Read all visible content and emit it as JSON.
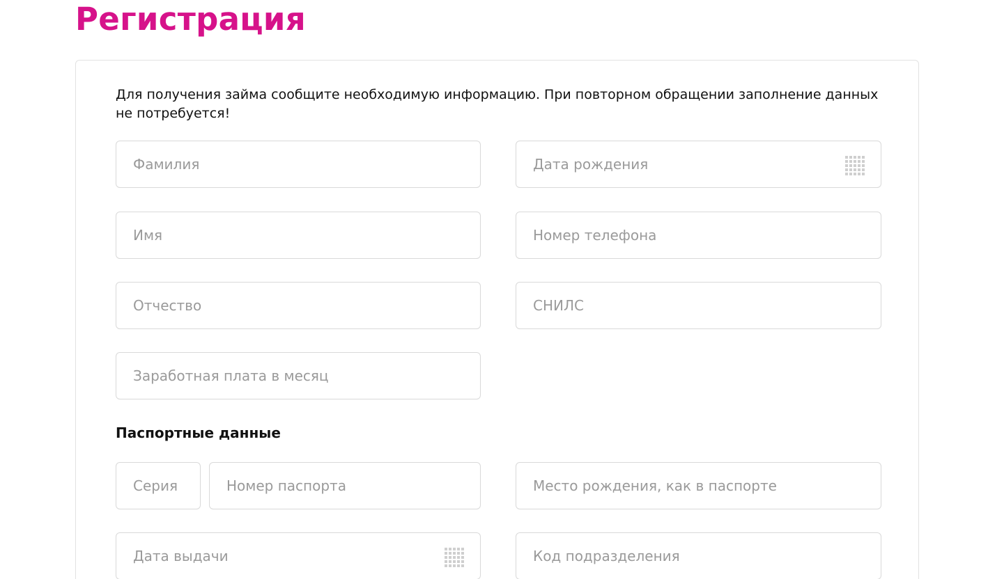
{
  "page": {
    "title": "Регистрация"
  },
  "form": {
    "intro": "Для получения займа сообщите необходимую информацию. При повторном обращении заполнение данных не потребуется!",
    "fields": {
      "last_name": {
        "placeholder": "Фамилия",
        "value": ""
      },
      "birth_date": {
        "placeholder": "Дата рождения",
        "value": "",
        "icon": "calendar-icon"
      },
      "first_name": {
        "placeholder": "Имя",
        "value": ""
      },
      "phone": {
        "placeholder": "Номер телефона",
        "value": ""
      },
      "patronymic": {
        "placeholder": "Отчество",
        "value": ""
      },
      "snils": {
        "placeholder": "СНИЛС",
        "value": ""
      },
      "salary": {
        "placeholder": "Заработная плата в месяц",
        "value": ""
      }
    },
    "passport": {
      "section_title": "Паспортные данные",
      "fields": {
        "series": {
          "placeholder": "Серия",
          "value": ""
        },
        "number": {
          "placeholder": "Номер паспорта",
          "value": ""
        },
        "birth_place": {
          "placeholder": "Место рождения, как в паспорте",
          "value": ""
        },
        "issue_date": {
          "placeholder": "Дата выдачи",
          "value": "",
          "icon": "calendar-icon"
        },
        "division_code": {
          "placeholder": "Код подразделения",
          "value": ""
        }
      }
    }
  },
  "colors": {
    "accent": "#d6128a",
    "border": "#d9d9d9",
    "placeholder": "#9a9a9a",
    "icon": "#cfcfcf"
  }
}
